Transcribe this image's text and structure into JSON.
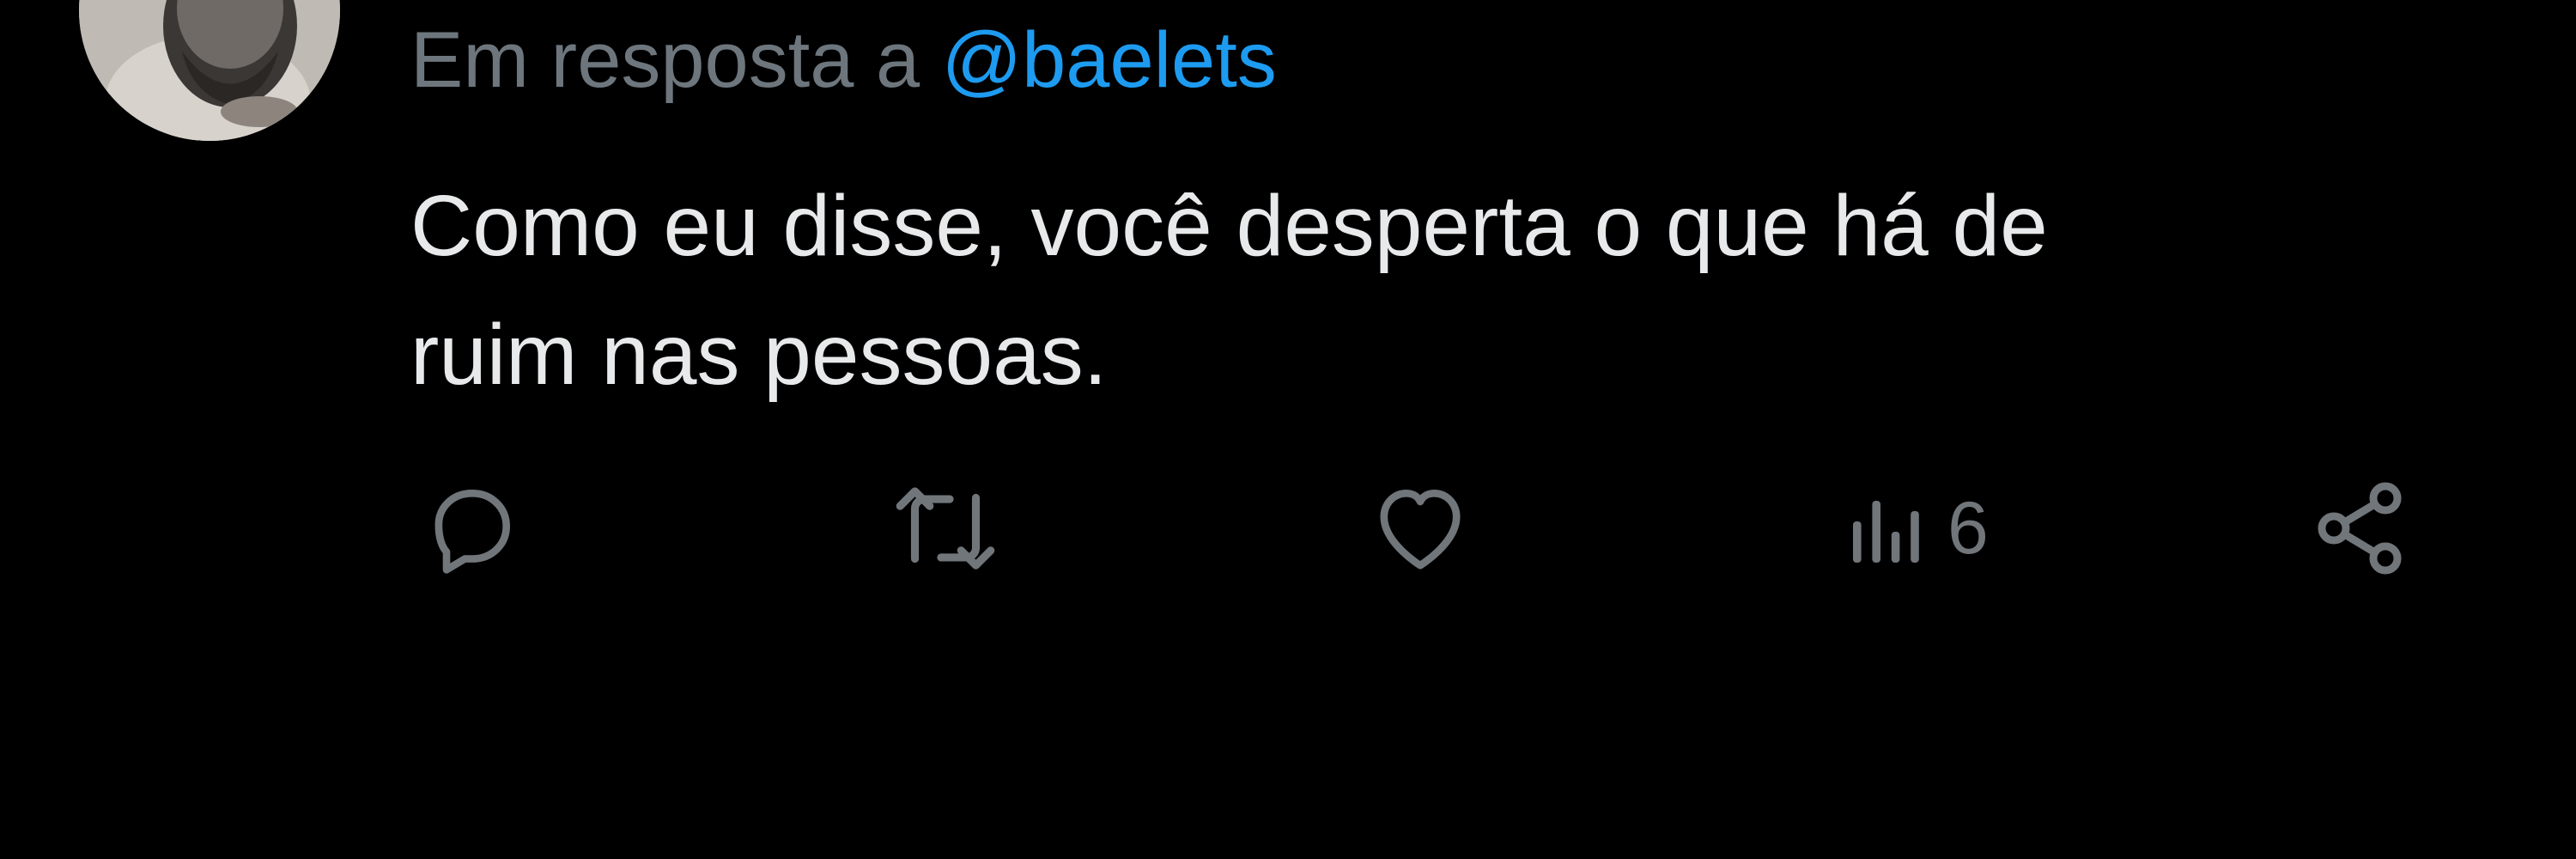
{
  "reply": {
    "prefix": "Em resposta a",
    "mention": "@baelets"
  },
  "body": {
    "lines": [
      "Como eu disse, você desperta o que há de",
      "ruim nas pessoas."
    ]
  },
  "actions": {
    "reply_icon": "speech-bubble-icon",
    "retweet_icon": "retweet-icon",
    "like_icon": "heart-icon",
    "views_icon": "bar-chart-icon",
    "views_count": "6",
    "share_icon": "share-icon"
  },
  "colors": {
    "background": "#000000",
    "text": "#e7e9ea",
    "muted": "#71767b",
    "accent": "#1d9bf0"
  }
}
